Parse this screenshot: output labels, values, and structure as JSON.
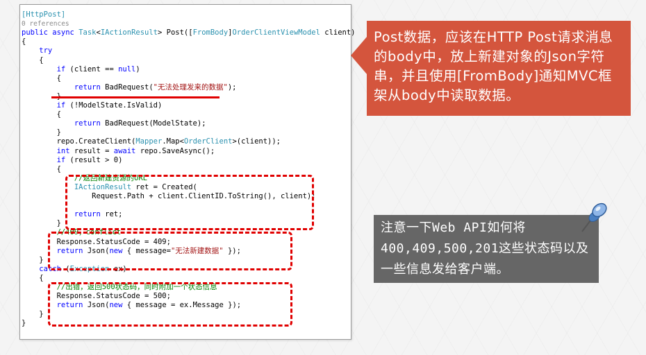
{
  "code": {
    "lines": [
      [
        {
          "c": "attr",
          "t": "[HttpPost]"
        }
      ],
      [
        {
          "c": "ref",
          "t": "0 references"
        }
      ],
      [
        {
          "c": "kw",
          "t": "public async "
        },
        {
          "c": "type",
          "t": "Task"
        },
        {
          "c": "",
          "t": "<"
        },
        {
          "c": "type",
          "t": "IActionResult"
        },
        {
          "c": "",
          "t": "> Post(["
        },
        {
          "c": "attr",
          "t": "FromBody"
        },
        {
          "c": "",
          "t": "]"
        },
        {
          "c": "type",
          "t": "OrderClientViewModel"
        },
        {
          "c": "",
          "t": " client)"
        }
      ],
      [
        {
          "c": "",
          "t": "{"
        }
      ],
      [
        {
          "c": "kw",
          "t": "    try"
        }
      ],
      [
        {
          "c": "",
          "t": "    {"
        }
      ],
      [
        {
          "c": "",
          "t": "        "
        },
        {
          "c": "kw",
          "t": "if"
        },
        {
          "c": "",
          "t": " (client == "
        },
        {
          "c": "kw",
          "t": "null"
        },
        {
          "c": "",
          "t": ")"
        }
      ],
      [
        {
          "c": "",
          "t": "        {"
        }
      ],
      [
        {
          "c": "",
          "t": "            "
        },
        {
          "c": "kw",
          "t": "return"
        },
        {
          "c": "",
          "t": " BadRequest("
        },
        {
          "c": "str",
          "t": "\"无法处理发来的数据\""
        },
        {
          "c": "",
          "t": ");"
        }
      ],
      [
        {
          "c": "",
          "t": "        }"
        }
      ],
      [
        {
          "c": "",
          "t": "        "
        },
        {
          "c": "kw",
          "t": "if"
        },
        {
          "c": "",
          "t": " (!ModelState.IsValid)"
        }
      ],
      [
        {
          "c": "",
          "t": "        {"
        }
      ],
      [
        {
          "c": "",
          "t": "            "
        },
        {
          "c": "kw",
          "t": "return"
        },
        {
          "c": "",
          "t": " BadRequest(ModelState);"
        }
      ],
      [
        {
          "c": "",
          "t": "        }"
        }
      ],
      [
        {
          "c": "",
          "t": "        repo.CreateClient("
        },
        {
          "c": "type",
          "t": "Mapper"
        },
        {
          "c": "",
          "t": ".Map<"
        },
        {
          "c": "type",
          "t": "OrderClient"
        },
        {
          "c": "",
          "t": ">(client));"
        }
      ],
      [
        {
          "c": "",
          "t": "        "
        },
        {
          "c": "kw",
          "t": "int"
        },
        {
          "c": "",
          "t": " result = "
        },
        {
          "c": "kw",
          "t": "await"
        },
        {
          "c": "",
          "t": " repo.SaveAsync();"
        }
      ],
      [
        {
          "c": "",
          "t": "        "
        },
        {
          "c": "kw",
          "t": "if"
        },
        {
          "c": "",
          "t": " (result > 0)"
        }
      ],
      [
        {
          "c": "",
          "t": "        {"
        }
      ],
      [
        {
          "c": "",
          "t": "            "
        },
        {
          "c": "cmt",
          "t": "//返回新建资源的URL"
        }
      ],
      [
        {
          "c": "",
          "t": "            "
        },
        {
          "c": "type",
          "t": "IActionResult"
        },
        {
          "c": "",
          "t": " ret = Created("
        }
      ],
      [
        {
          "c": "",
          "t": "                Request.Path + client.ClientID.ToString(), client);"
        }
      ],
      [
        {
          "c": "",
          "t": ""
        }
      ],
      [
        {
          "c": "",
          "t": "            "
        },
        {
          "c": "kw",
          "t": "return"
        },
        {
          "c": "",
          "t": " ret;"
        }
      ],
      [
        {
          "c": "",
          "t": "        }"
        }
      ],
      [
        {
          "c": "",
          "t": "        "
        },
        {
          "c": "cmt",
          "t": "//409，conflict"
        }
      ],
      [
        {
          "c": "",
          "t": "        Response.StatusCode = 409;"
        }
      ],
      [
        {
          "c": "",
          "t": "        "
        },
        {
          "c": "kw",
          "t": "return"
        },
        {
          "c": "",
          "t": " Json("
        },
        {
          "c": "kw",
          "t": "new"
        },
        {
          "c": "",
          "t": " { message="
        },
        {
          "c": "str",
          "t": "\"无法新建数据\""
        },
        {
          "c": "",
          "t": " });"
        }
      ],
      [
        {
          "c": "",
          "t": "    }"
        }
      ],
      [
        {
          "c": "",
          "t": "    "
        },
        {
          "c": "kw",
          "t": "catch"
        },
        {
          "c": "",
          "t": " ("
        },
        {
          "c": "type",
          "t": "Exception"
        },
        {
          "c": "",
          "t": " ex)"
        }
      ],
      [
        {
          "c": "",
          "t": "    {"
        }
      ],
      [
        {
          "c": "",
          "t": "        "
        },
        {
          "c": "cmt",
          "t": "//出错，返回500状态码，同时附加一个状态信息"
        }
      ],
      [
        {
          "c": "",
          "t": "        Response.StatusCode = 500;"
        }
      ],
      [
        {
          "c": "",
          "t": "        "
        },
        {
          "c": "kw",
          "t": "return"
        },
        {
          "c": "",
          "t": " Json("
        },
        {
          "c": "kw",
          "t": "new"
        },
        {
          "c": "",
          "t": " { message = ex.Message });"
        }
      ],
      [
        {
          "c": "",
          "t": "    }"
        }
      ],
      [
        {
          "c": "",
          "t": "}"
        }
      ]
    ]
  },
  "callout_red": {
    "text": "Post数据，应该在HTTP Post请求消息的body中，放上新建对象的Json字符串，并且使用[FromBody]通知MVC框架从body中读取数据。"
  },
  "callout_gray": {
    "text": "注意一下Web API如何将400,409,500,201这些状态码以及一些信息发给客户端。"
  },
  "colors": {
    "accent_red": "#e00000",
    "callout_red_bg": "#d4553d",
    "callout_gray_bg": "#666666"
  }
}
